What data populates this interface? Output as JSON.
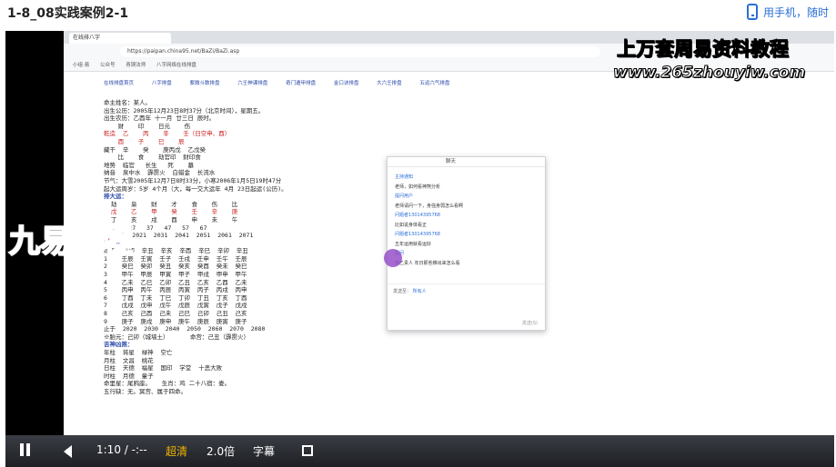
{
  "page": {
    "title": "1-8_08实践案例2-1",
    "phone_label": "用手机，随时"
  },
  "overlay": {
    "headline": "上万套周易资料教程",
    "site": "www.265zhouyiw.com",
    "logo": "九易教程"
  },
  "browser": {
    "tab_title": "在线排八字",
    "url": "https://paipan.china95.net/BaZi/BaZi.asp",
    "bookmarks": [
      "小组·易",
      "公众号",
      "青铜法师",
      "八字网络在线排盘"
    ],
    "nav_links": [
      "在线排盘首页",
      "八字排盘",
      "紫微斗数排盘",
      "六壬神课排盘",
      "奇门遁甲排盘",
      "金口诀排盘",
      "大六壬排盘",
      "五运六气排盘"
    ]
  },
  "bazi": {
    "lines": [
      "命主姓名：某人。",
      "出生公历：2005年12月23日8时37分（北京时间），星期五。",
      "出生农历：乙酉年 十一月 廿三日 辰时。",
      "    财    印    日元    伤",
      "乾造  乙    丙    辛    壬（日空申、酉）",
      "    酉    子    巳    辰",
      "藏干  辛    癸    庚丙戊  乙戊癸",
      "    比    食    劫官印  财印食",
      "地势  临官   长生   死    墓",
      "纳音  泉中水  霹雳火  白蜡金  长流水",
      "节气：大雪2005年12月7日8时33分，小寒2006年1月5日19时47分",
      "起大运周岁：5岁 4个月（大，每一交大运年 4月 23日起运(公历)。",
      "排大运：",
      "  劫    枭    财    才    食    伤    比",
      "  戊    乙    甲    癸    壬    辛    庚",
      "  丁    亥    戌    酉    申    未    午",
      "  17   27   37   47   57   67",
      "  2011  2021  2031  2041  2051  2061  2071",
      "排流年：",
      "始于  辛卯  辛丑  辛亥  辛酉  辛巳  辛卯  辛丑",
      "1    壬辰  壬寅  壬子  壬戌  壬申  壬午  壬辰",
      "2    癸巳  癸卯  癸丑  癸亥  癸酉  癸未  癸巳",
      "3    甲午  甲辰  甲寅  甲子  甲戌  甲申  甲午",
      "4    乙未  乙巳  乙卯  乙丑  乙亥  乙酉  乙未",
      "5    丙申  丙午  丙辰  丙寅  丙子  丙戌  丙申",
      "6    丁酉  丁未  丁巳  丁卯  丁丑  丁亥  丁酉",
      "7    戊戌  戊申  戊午  戊辰  戊寅  戊子  戊戌",
      "8    己亥  己酉  己未  己巳  己卯  己丑  己亥",
      "9    庚子  庚戌  庚申  庚午  庚辰  庚寅  庚子",
      "止于  2020  2030  2040  2050  2060  2070  2080",
      "※胎元：己卯（城墙土）      命宫：己丑（霹雳火）",
      "吉神凶煞：",
      "年柱  将星  禄神  空亡",
      "月柱  文昌  桃花",
      "日柱  天德  福星  国印  学堂  十恶大败",
      "时柱  月德  童子",
      "命里星：尾鸦座。   生肖：鸡 二十八宿：娄。",
      "五行缺：无。冥宫、属于四命。"
    ]
  },
  "chat": {
    "title": "聊天",
    "messages": [
      {
        "t": "主持通知",
        "u": true
      },
      {
        "t": "老师，如何看神煞分析",
        "u": false
      },
      {
        "t": "提问用户",
        "u": true
      },
      {
        "t": "老师请问一下，身强身弱怎么看啊",
        "u": false
      },
      {
        "t": "问题者13014395768",
        "u": true
      },
      {
        "t": "比如说身体看正",
        "u": false
      },
      {
        "t": "问题者13014395768",
        "u": true
      },
      {
        "t": "五年运用就看运好",
        "u": false
      },
      {
        "t": "提问",
        "u": true
      },
      {
        "t": "天乙贵人 年日那些推出来怎么看",
        "u": false
      }
    ],
    "send_label": "发送至：",
    "send_target": "所有人",
    "send_button": "发送(S)"
  },
  "player": {
    "time_current": "1:10",
    "time_sep": "/",
    "time_total": "-:--",
    "quality": "超清",
    "speed": "2.0倍",
    "subtitle": "字幕"
  }
}
